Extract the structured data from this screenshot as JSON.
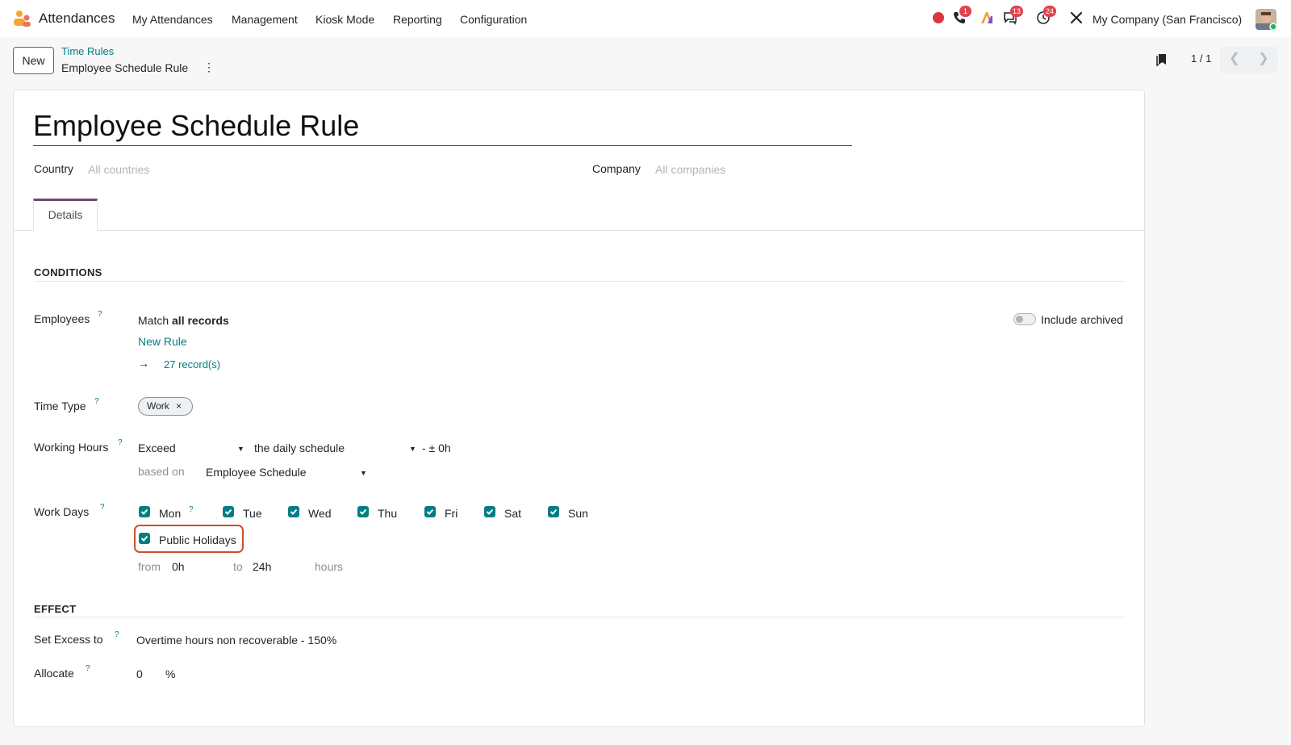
{
  "navbar": {
    "app_name": "Attendances",
    "menu": [
      "My Attendances",
      "Management",
      "Kiosk Mode",
      "Reporting",
      "Configuration"
    ],
    "badges": {
      "phone": "1",
      "chat": "13",
      "activity": "24"
    },
    "company": "My Company (San Francisco)",
    "icons": [
      "record-dot-icon",
      "phone-icon",
      "ai-icon",
      "chat-icon",
      "clock-icon",
      "tools-icon"
    ],
    "colors": {
      "record_dot": "#d9363e",
      "badge": "#e0434f"
    }
  },
  "control_panel": {
    "new_label": "New",
    "breadcrumb_parent": "Time Rules",
    "breadcrumb_current": "Employee Schedule Rule",
    "kebab": "⋮",
    "pager": "1 / 1"
  },
  "record": {
    "title": "Employee Schedule Rule",
    "country_label": "Country",
    "country_placeholder": "All countries",
    "company_label": "Company",
    "company_placeholder": "All companies",
    "tab_details": "Details"
  },
  "conditions": {
    "section_title": "CONDITIONS",
    "employees_label": "Employees",
    "match_prefix": "Match",
    "match_value": "all records",
    "new_rule": "New Rule",
    "arrow": "→",
    "records_count": "27 record(s)",
    "include_archived": "Include archived",
    "time_type_label": "Time Type",
    "time_type_tag": "Work",
    "time_type_tag_remove": "×",
    "working_hours_label": "Working Hours",
    "working_hours_op": "Exceed",
    "working_hours_ref": "the daily schedule",
    "tolerance": "- ± 0h",
    "based_on_label": "based on",
    "based_on_value": "Employee Schedule",
    "work_days_label": "Work Days",
    "days": [
      "Mon",
      "Tue",
      "Wed",
      "Thu",
      "Fri",
      "Sat",
      "Sun"
    ],
    "public_holidays": "Public Holidays",
    "from_label": "from",
    "from_value": "0h",
    "to_label": "to",
    "to_value": "24h",
    "hours_label": "hours",
    "help": "?"
  },
  "effect": {
    "section_title": "EFFECT",
    "set_excess_label": "Set Excess to",
    "set_excess_value": "Overtime hours non recoverable - 150%",
    "allocate_label": "Allocate",
    "allocate_value": "0",
    "allocate_unit": "%"
  },
  "colors": {
    "accent": "#017e84",
    "tab_accent": "#714b67",
    "highlight": "#c9502b"
  }
}
